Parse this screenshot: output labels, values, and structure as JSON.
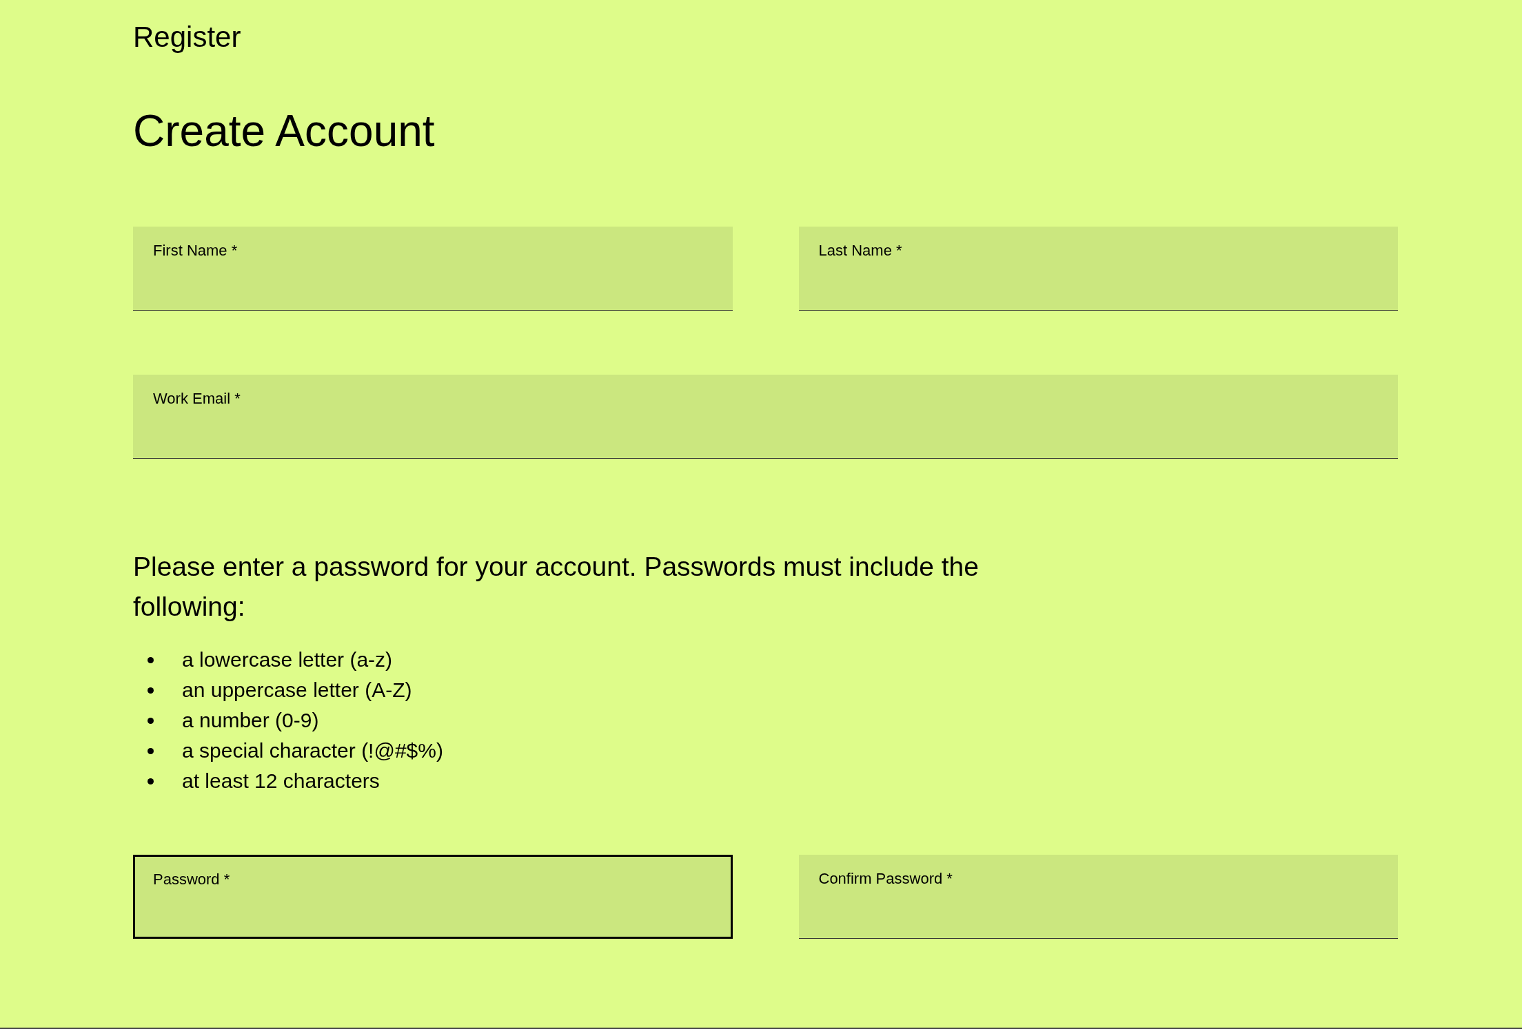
{
  "breadcrumb": "Register",
  "title": "Create Account",
  "name_fields": [
    {
      "label": "First Name *",
      "focused": false
    },
    {
      "label": "Last Name *",
      "focused": false
    }
  ],
  "email_field": {
    "label": "Work Email *",
    "focused": false
  },
  "password_intro": "Please enter a password for your account. Passwords must include the following:",
  "requirements": [
    "a lowercase letter (a-z)",
    "an uppercase letter (A-Z)",
    "a number (0-9)",
    "a special character (!@#$%)",
    "at least 12 characters"
  ],
  "password_fields": [
    {
      "label": "Password *",
      "focused": true
    },
    {
      "label": "Confirm Password *",
      "focused": false
    }
  ]
}
